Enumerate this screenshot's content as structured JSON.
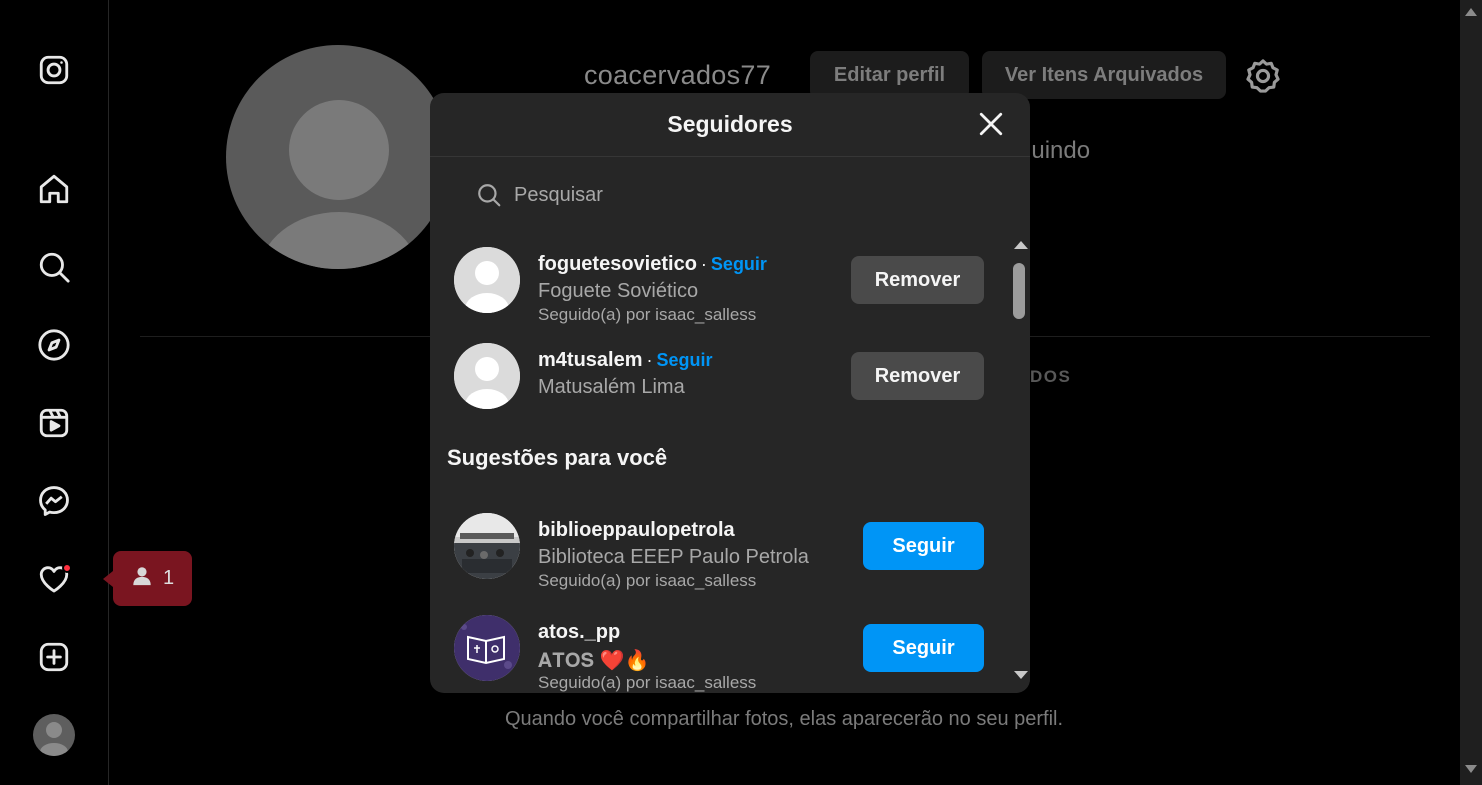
{
  "profile": {
    "username": "coacervados77",
    "edit_profile_label": "Editar perfil",
    "archived_label": "Ver Itens Arquivados",
    "following_partial": "guindo",
    "tab_partial": "DOS",
    "empty_message": "Quando você compartilhar fotos, elas aparecerão no seu perfil."
  },
  "sidebar": {
    "notification_tooltip_count": "1",
    "icons": [
      "instagram-icon",
      "home-icon",
      "search-icon",
      "explore-icon",
      "reels-icon",
      "messenger-icon",
      "heart-icon",
      "create-icon"
    ]
  },
  "modal": {
    "title": "Seguidores",
    "search_placeholder": "Pesquisar",
    "followers": [
      {
        "username": "foguetesovietico",
        "follow_label": "Seguir",
        "fullname": "Foguete Soviético",
        "followed_by": "Seguido(a) por isaac_salless",
        "action": "Remover"
      },
      {
        "username": "m4tusalem",
        "follow_label": "Seguir",
        "fullname": "Matusalém Lima",
        "followed_by": "",
        "action": "Remover"
      }
    ],
    "suggestions_title": "Sugestões para você",
    "suggestions": [
      {
        "username": "biblioeppaulopetrola",
        "fullname": "Biblioteca EEEP Paulo Petrola",
        "followed_by": "Seguido(a) por isaac_salless",
        "action": "Seguir"
      },
      {
        "username": "atos._pp",
        "fullname": "𝐀𝐓𝐎𝐒 ❤️🔥",
        "followed_by": "Seguido(a) por isaac_salless",
        "action": "Seguir"
      }
    ]
  },
  "colors": {
    "accent": "#0095f6",
    "modal_bg": "#262626",
    "tooltip_bg": "#7a1520",
    "notification_dot": "#ff3040"
  }
}
